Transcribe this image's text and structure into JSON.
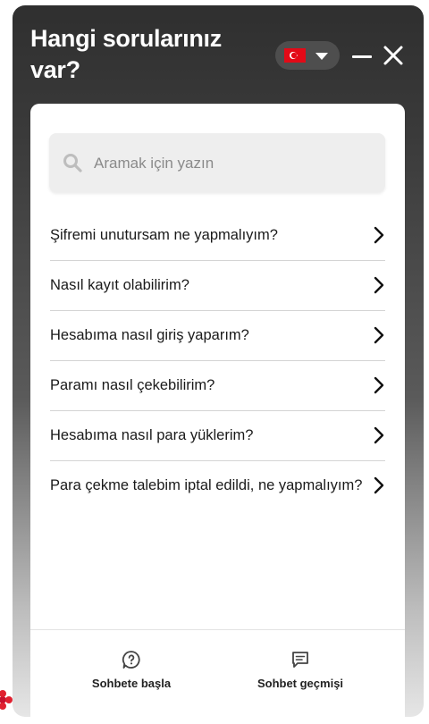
{
  "header": {
    "title": "Hangi sorularınız var?",
    "language_flag": "turkey-flag"
  },
  "search": {
    "placeholder": "Aramak için yazın",
    "value": ""
  },
  "faq": [
    {
      "question": "Şifremi unutursam ne yapmalıyım?"
    },
    {
      "question": "Nasıl kayıt olabilirim?"
    },
    {
      "question": "Hesabıma nasıl giriş yaparım?"
    },
    {
      "question": "Paramı nasıl çekebilirim?"
    },
    {
      "question": "Hesabıma nasıl para yüklerim?"
    },
    {
      "question": "Para çekme talebim iptal edildi, ne yapmalıyım?"
    }
  ],
  "footer": {
    "start_chat_label": "Sohbete başla",
    "chat_history_label": "Sohbet geçmişi"
  },
  "colors": {
    "header_dark": "#2f2f2f",
    "flag_red": "#e30a17",
    "panel_bg": "#ffffff",
    "text": "#1a1a1a"
  }
}
